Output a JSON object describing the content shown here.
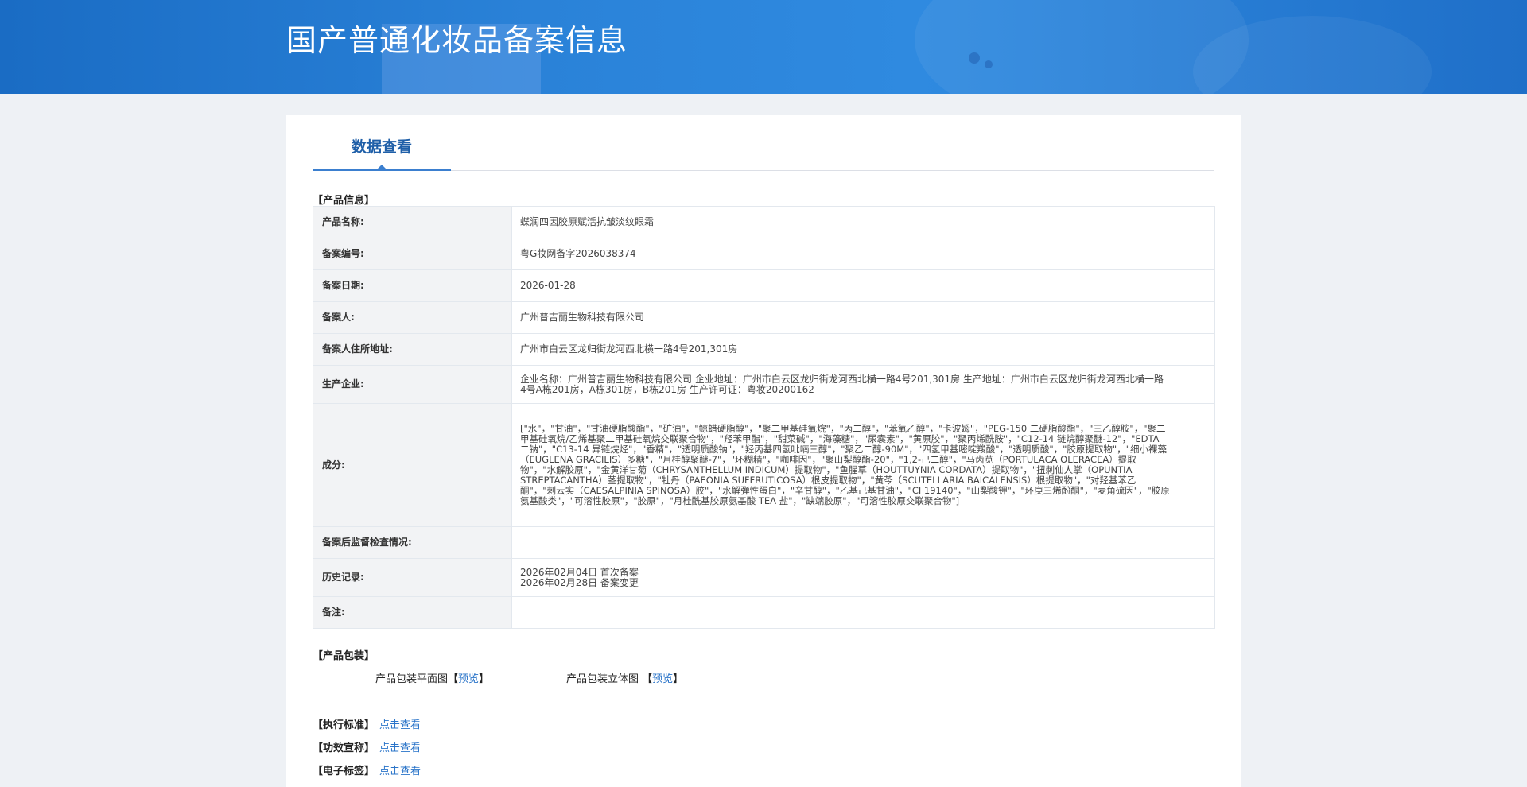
{
  "page": {
    "title": "国产普通化妆品备案信息"
  },
  "tabs": [
    {
      "label": "数据查看"
    }
  ],
  "product_info": {
    "section_title": "【产品信息】",
    "rows": [
      {
        "label": "产品名称:",
        "value": "蝶润四因胶原赋活抗皱淡纹眼霜"
      },
      {
        "label": "备案编号:",
        "value": "粤G妆网备字2026038374"
      },
      {
        "label": "备案日期:",
        "value": "2026-01-28"
      },
      {
        "label": "备案人:",
        "value": "广州普吉丽生物科技有限公司"
      },
      {
        "label": "备案人住所地址:",
        "value": "广州市白云区龙归街龙河西北横一路4号201,301房"
      },
      {
        "label": "生产企业:",
        "value": "企业名称：广州普吉丽生物科技有限公司 企业地址：广州市白云区龙归街龙河西北横一路4号201,301房 生产地址：广州市白云区龙归街龙河西北横一路4号A栋201房，A栋301房，B栋201房 生产许可证：粤妆20200162"
      },
      {
        "label": "成分:",
        "value": "[\"水\"，\"甘油\"，\"甘油硬脂酸酯\"，\"矿油\"，\"鲸蜡硬脂醇\"，\"聚二甲基硅氧烷\"，\"丙二醇\"，\"苯氧乙醇\"，\"卡波姆\"，\"PEG-150 二硬脂酸酯\"，\"三乙醇胺\"，\"聚二甲基硅氧烷/乙烯基聚二甲基硅氧烷交联聚合物\"，\"羟苯甲酯\"，\"甜菜碱\"，\"海藻糖\"，\"尿囊素\"，\"黄原胶\"，\"聚丙烯酰胺\"，\"C12-14 链烷醇聚醚-12\"，\"EDTA 二钠\"，\"C13-14 异链烷烃\"，\"香精\"，\"透明质酸钠\"，\"羟丙基四氢吡喃三醇\"，\"聚乙二醇-90M\"，\"四氢甲基嘧啶羧酸\"，\"透明质酸\"，\"胶原提取物\"，\"细小裸藻（EUGLENA GRACILIS）多糖\"，\"月桂醇聚醚-7\"，\"环糊精\"，\"咖啡因\"，\"聚山梨醇酯-20\"，\"1,2-己二醇\"，\"马齿苋（PORTULACA OLERACEA）提取物\"，\"水解胶原\"，\"金黄洋甘菊（CHRYSANTHELLUM INDICUM）提取物\"，\"鱼腥草（HOUTTUYNIA CORDATA）提取物\"，\"扭刺仙人掌（OPUNTIA STREPTACANTHA）茎提取物\"，\"牡丹（PAEONIA SUFFRUTICOSA）根皮提取物\"，\"黄芩（SCUTELLARIA BAICALENSIS）根提取物\"，\"对羟基苯乙酮\"，\"刺云实（CAESALPINIA SPINOSA）胶\"，\"水解弹性蛋白\"，\"辛甘醇\"，\"乙基己基甘油\"，\"CI 19140\"，\"山梨酸钾\"，\"环庚三烯酚酮\"，\"麦角硫因\"，\"胶原氨基酸类\"，\"可溶性胶原\"，\"胶原\"，\"月桂酰基胶原氨基酸 TEA 盐\"，\"缺端胶原\"，\"可溶性胶原交联聚合物\"]"
      },
      {
        "label": "备案后监督检查情况:",
        "value": ""
      },
      {
        "label": "历史记录:",
        "value_lines": [
          "2026年02月04日 首次备案",
          "2026年02月28日 备案变更"
        ]
      },
      {
        "label": "备注:",
        "value": ""
      }
    ]
  },
  "packaging": {
    "section_title": "【产品包装】",
    "items": [
      {
        "label": "产品包装平面图",
        "link": "预览"
      },
      {
        "label": "产品包装立体图",
        "link": "预览"
      }
    ]
  },
  "extras": [
    {
      "label": "【执行标准】",
      "link": "点击查看"
    },
    {
      "label": "【功效宣称】",
      "link": "点击查看"
    },
    {
      "label": "【电子标签】",
      "link": "点击查看"
    }
  ]
}
